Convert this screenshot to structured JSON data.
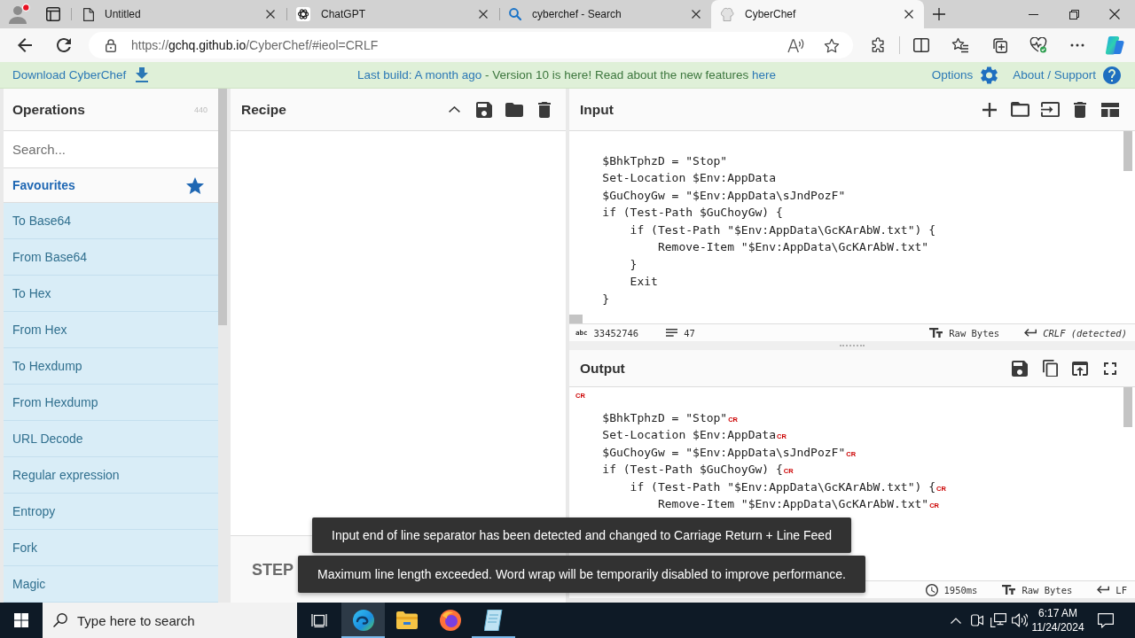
{
  "browser": {
    "tabs": [
      {
        "title": "Untitled",
        "kind": "document",
        "selected": false
      },
      {
        "title": "ChatGPT",
        "kind": "chat",
        "selected": false
      },
      {
        "title": "cyberchef - Search",
        "kind": "search",
        "selected": false
      },
      {
        "title": "CyberChef",
        "kind": "chef",
        "selected": true
      }
    ],
    "address": {
      "scheme": "https://",
      "host": "gchq.github.io",
      "path": "/CyberChef/#ieol=CRLF"
    }
  },
  "banner": {
    "download": "Download CyberChef",
    "notice": [
      {
        "text": "Last build: A month ago",
        "kind": "link"
      },
      {
        "text": " - Version 10 is here! Read about the new features ",
        "kind": "text"
      },
      {
        "text": "here",
        "kind": "link"
      }
    ],
    "options": "Options",
    "about": "About / Support"
  },
  "operations": {
    "title": "Operations",
    "count": "440",
    "search": {
      "placeholder": "Search..."
    },
    "favourites": "Favourites",
    "items": [
      "To Base64",
      "From Base64",
      "To Hex",
      "From Hex",
      "To Hexdump",
      "From Hexdump",
      "URL Decode",
      "Regular expression",
      "Entropy",
      "Fork",
      "Magic"
    ]
  },
  "recipe": {
    "title": "Recipe",
    "step": "STEP"
  },
  "input": {
    "title": "Input",
    "lines": [
      "    $BhkTphzD = \"Stop\"",
      "    Set-Location $Env:AppData",
      "    $GuChoyGw = \"$Env:AppData\\sJndPozF\"",
      "    if (Test-Path $GuChoyGw) {",
      "        if (Test-Path \"$Env:AppData\\GcKArAbW.txt\") {",
      "            Remove-Item \"$Env:AppData\\GcKArAbW.txt\"",
      "        }",
      "        Exit",
      "    }"
    ],
    "status": {
      "length_icon": "abc",
      "length": "33452746",
      "lines": "47",
      "format": "Raw Bytes",
      "eol": "CRLF (detected)"
    }
  },
  "output": {
    "title": "Output",
    "lines": [
      {
        "marker": "CR"
      },
      {
        "text": "    $BhkTphzD = \"Stop\"",
        "marker": "CR"
      },
      {
        "text": "    Set-Location $Env:AppData",
        "marker": "CR"
      },
      {
        "text": "    $GuChoyGw = \"$Env:AppData\\sJndPozF\"",
        "marker": "CR"
      },
      {
        "text": "    if (Test-Path $GuChoyGw) {",
        "marker": "CR"
      },
      {
        "text": "        if (Test-Path \"$Env:AppData\\GcKArAbW.txt\") {",
        "marker": "CR"
      },
      {
        "text": "            Remove-Item \"$Env:AppData\\GcKArAbW.txt\"",
        "marker": "CR"
      }
    ],
    "status": {
      "time": "1950ms",
      "format": "Raw Bytes",
      "eol": "LF"
    }
  },
  "toasts": [
    "Input end of line separator has been detected and changed to Carriage Return + Line Feed",
    "Maximum line length exceeded. Word wrap will be temporarily disabled to improve performance."
  ],
  "taskbar": {
    "search": {
      "placeholder": "Type here to search"
    },
    "apps": [
      {
        "kind": "edge",
        "selected": true,
        "running": true
      },
      {
        "kind": "explorer",
        "selected": false,
        "running": false
      },
      {
        "kind": "firefox",
        "selected": false,
        "running": false
      },
      {
        "kind": "notes",
        "selected": false,
        "running": true
      }
    ],
    "time": "6:17 AM",
    "date": "11/24/2024"
  }
}
